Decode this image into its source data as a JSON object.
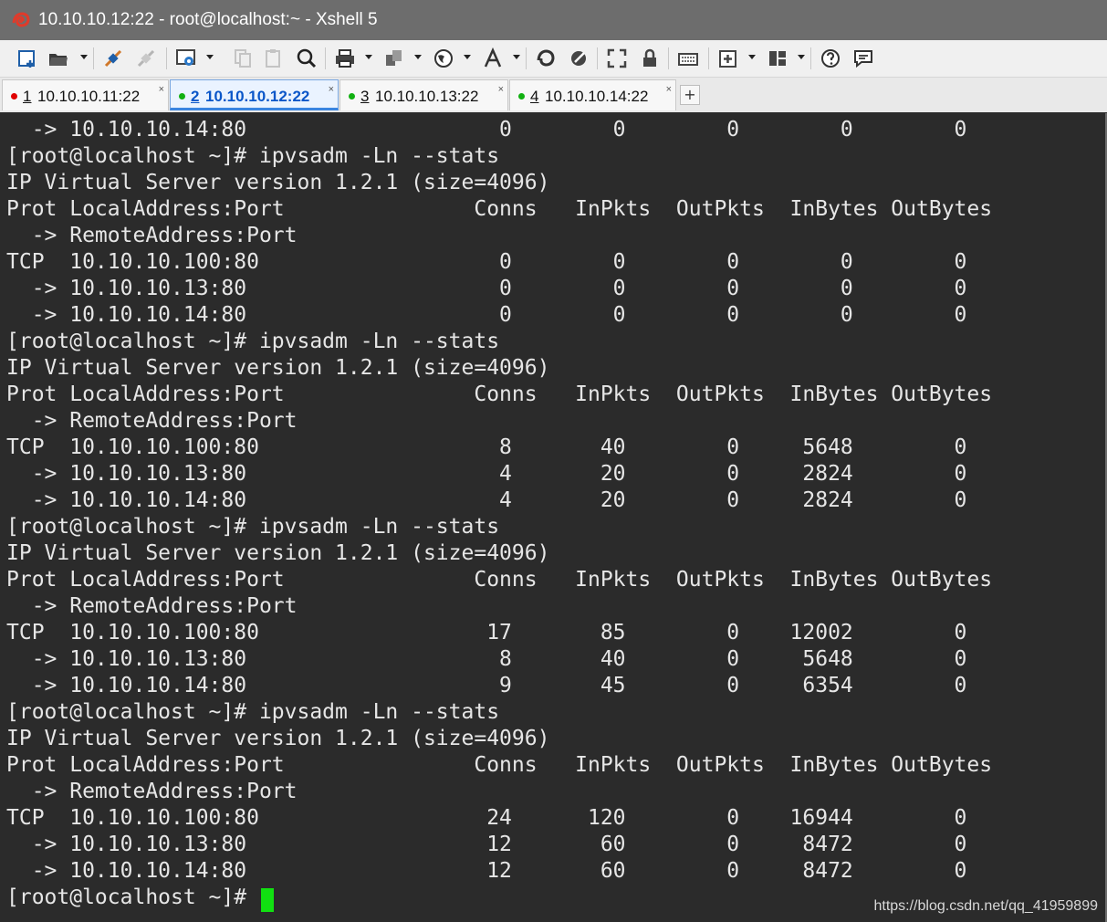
{
  "window": {
    "title": "10.10.10.12:22 - root@localhost:~ - Xshell 5"
  },
  "toolbar": {
    "icons": [
      "new-session",
      "open-folder",
      "connect",
      "disconnect",
      "properties",
      "copy",
      "paste",
      "find",
      "print",
      "transfer",
      "globe",
      "font",
      "xftp",
      "compose",
      "fullscreen",
      "lock",
      "keyboard",
      "add-tab",
      "layout",
      "help",
      "chat"
    ]
  },
  "tabs": [
    {
      "number": "1",
      "label": "10.10.10.11:22",
      "status_color": "#e00000",
      "active": false
    },
    {
      "number": "2",
      "label": "10.10.10.12:22",
      "status_color": "#11b011",
      "active": true
    },
    {
      "number": "3",
      "label": "10.10.10.13:22",
      "status_color": "#11b011",
      "active": false
    },
    {
      "number": "4",
      "label": "10.10.10.14:22",
      "status_color": "#11b011",
      "active": false
    }
  ],
  "new_tab_label": "+",
  "terminal": {
    "lines": [
      "  -> 10.10.10.14:80                    0        0        0        0        0",
      "[root@localhost ~]# ipvsadm -Ln --stats",
      "IP Virtual Server version 1.2.1 (size=4096)",
      "Prot LocalAddress:Port               Conns   InPkts  OutPkts  InBytes OutBytes",
      "  -> RemoteAddress:Port",
      "TCP  10.10.10.100:80                   0        0        0        0        0",
      "  -> 10.10.10.13:80                    0        0        0        0        0",
      "  -> 10.10.10.14:80                    0        0        0        0        0",
      "[root@localhost ~]# ipvsadm -Ln --stats",
      "IP Virtual Server version 1.2.1 (size=4096)",
      "Prot LocalAddress:Port               Conns   InPkts  OutPkts  InBytes OutBytes",
      "  -> RemoteAddress:Port",
      "TCP  10.10.10.100:80                   8       40        0     5648        0",
      "  -> 10.10.10.13:80                    4       20        0     2824        0",
      "  -> 10.10.10.14:80                    4       20        0     2824        0",
      "[root@localhost ~]# ipvsadm -Ln --stats",
      "IP Virtual Server version 1.2.1 (size=4096)",
      "Prot LocalAddress:Port               Conns   InPkts  OutPkts  InBytes OutBytes",
      "  -> RemoteAddress:Port",
      "TCP  10.10.10.100:80                  17       85        0    12002        0",
      "  -> 10.10.10.13:80                    8       40        0     5648        0",
      "  -> 10.10.10.14:80                    9       45        0     6354        0",
      "[root@localhost ~]# ipvsadm -Ln --stats",
      "IP Virtual Server version 1.2.1 (size=4096)",
      "Prot LocalAddress:Port               Conns   InPkts  OutPkts  InBytes OutBytes",
      "  -> RemoteAddress:Port",
      "TCP  10.10.10.100:80                  24      120        0    16944        0",
      "  -> 10.10.10.13:80                   12       60        0     8472        0",
      "  -> 10.10.10.14:80                   12       60        0     8472        0",
      "[root@localhost ~]# "
    ],
    "cursor_color": "#11e011"
  },
  "watermark": "https://blog.csdn.net/qq_41959899"
}
